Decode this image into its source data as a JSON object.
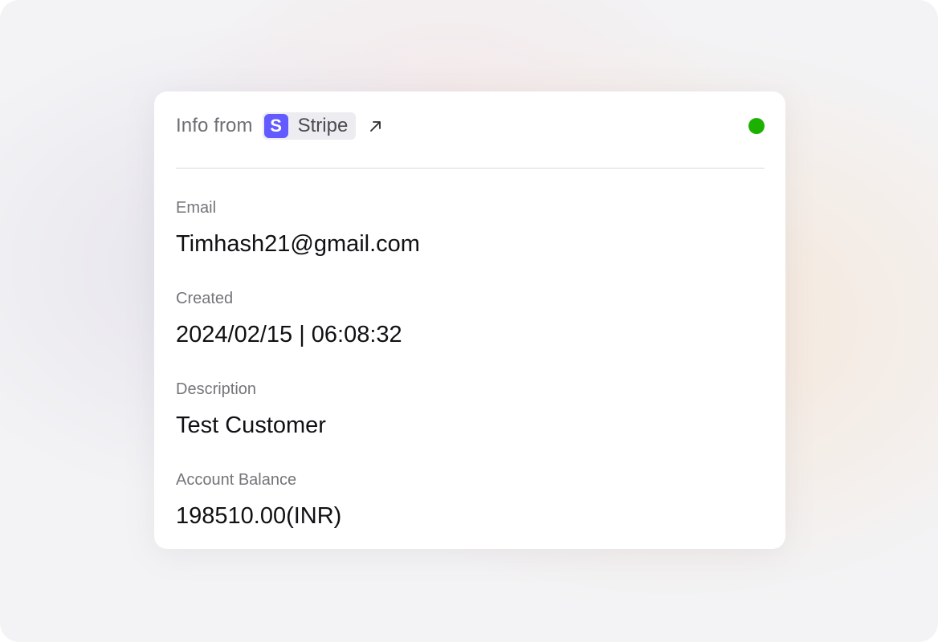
{
  "header": {
    "info_label": "Info from",
    "source_name": "Stripe",
    "source_logo_letter": "S",
    "source_logo_color": "#635bff",
    "link_icon": "arrow-up-right-icon",
    "status_color": "#1cb100"
  },
  "fields": {
    "email": {
      "label": "Email",
      "value": "Timhash21@gmail.com"
    },
    "created": {
      "label": "Created",
      "value": "2024/02/15 | 06:08:32"
    },
    "description": {
      "label": "Description",
      "value": "Test Customer"
    },
    "account_balance": {
      "label": "Account Balance",
      "value": "198510.00(INR)"
    }
  }
}
